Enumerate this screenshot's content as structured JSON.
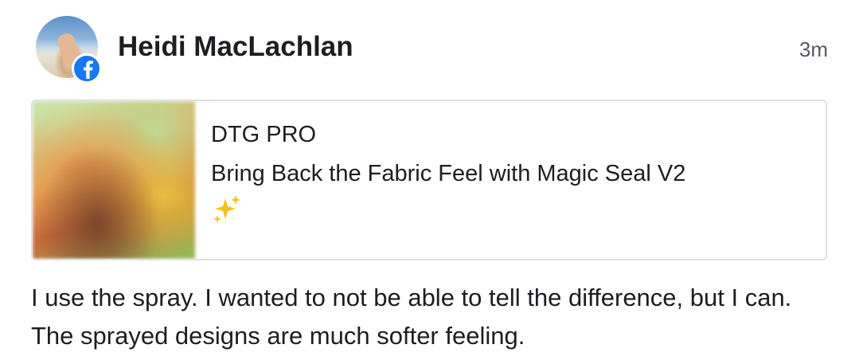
{
  "post": {
    "author_name": "Heidi MacLachlan",
    "timestamp": "3m",
    "avatar_icon": "profile-photo",
    "source_badge_icon": "facebook-icon",
    "badge_color": "#1877f2"
  },
  "link_card": {
    "site_name": "DTG PRO",
    "title": "Bring Back the Fabric Feel with Magic Seal V2",
    "emoji_icon": "sparkles-icon"
  },
  "comment": {
    "text": "I use the spray.  I wanted to not be able to tell the difference, but I can.  The sprayed designs are much softer feeling."
  }
}
